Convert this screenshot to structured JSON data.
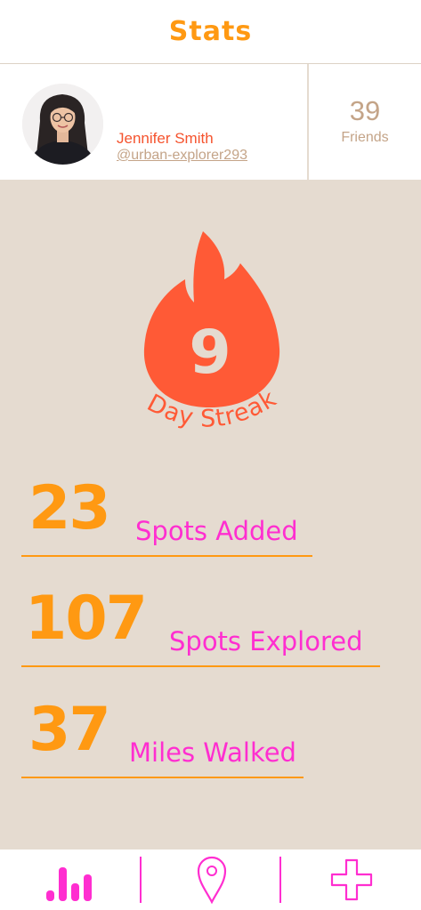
{
  "header": {
    "title": "Stats"
  },
  "profile": {
    "name": "Jennifer Smith",
    "handle": "@urban-explorer293",
    "friends_count": "39",
    "friends_label": "Friends"
  },
  "streak": {
    "days": "9",
    "label": "Day Streak"
  },
  "stats": [
    {
      "value": "23",
      "label": "Spots Added"
    },
    {
      "value": "107",
      "label": "Spots Explored"
    },
    {
      "value": "37",
      "label": "Miles Walked"
    }
  ],
  "tabbar": {
    "items": [
      {
        "icon": "bar-chart-icon"
      },
      {
        "icon": "map-pin-icon"
      },
      {
        "icon": "plus-icon"
      }
    ]
  },
  "colors": {
    "accent_orange": "#ff9912",
    "flame": "#ff5a36",
    "magenta": "#ff2ed0",
    "tan": "#c4a488",
    "background": "#e5dbd0"
  }
}
